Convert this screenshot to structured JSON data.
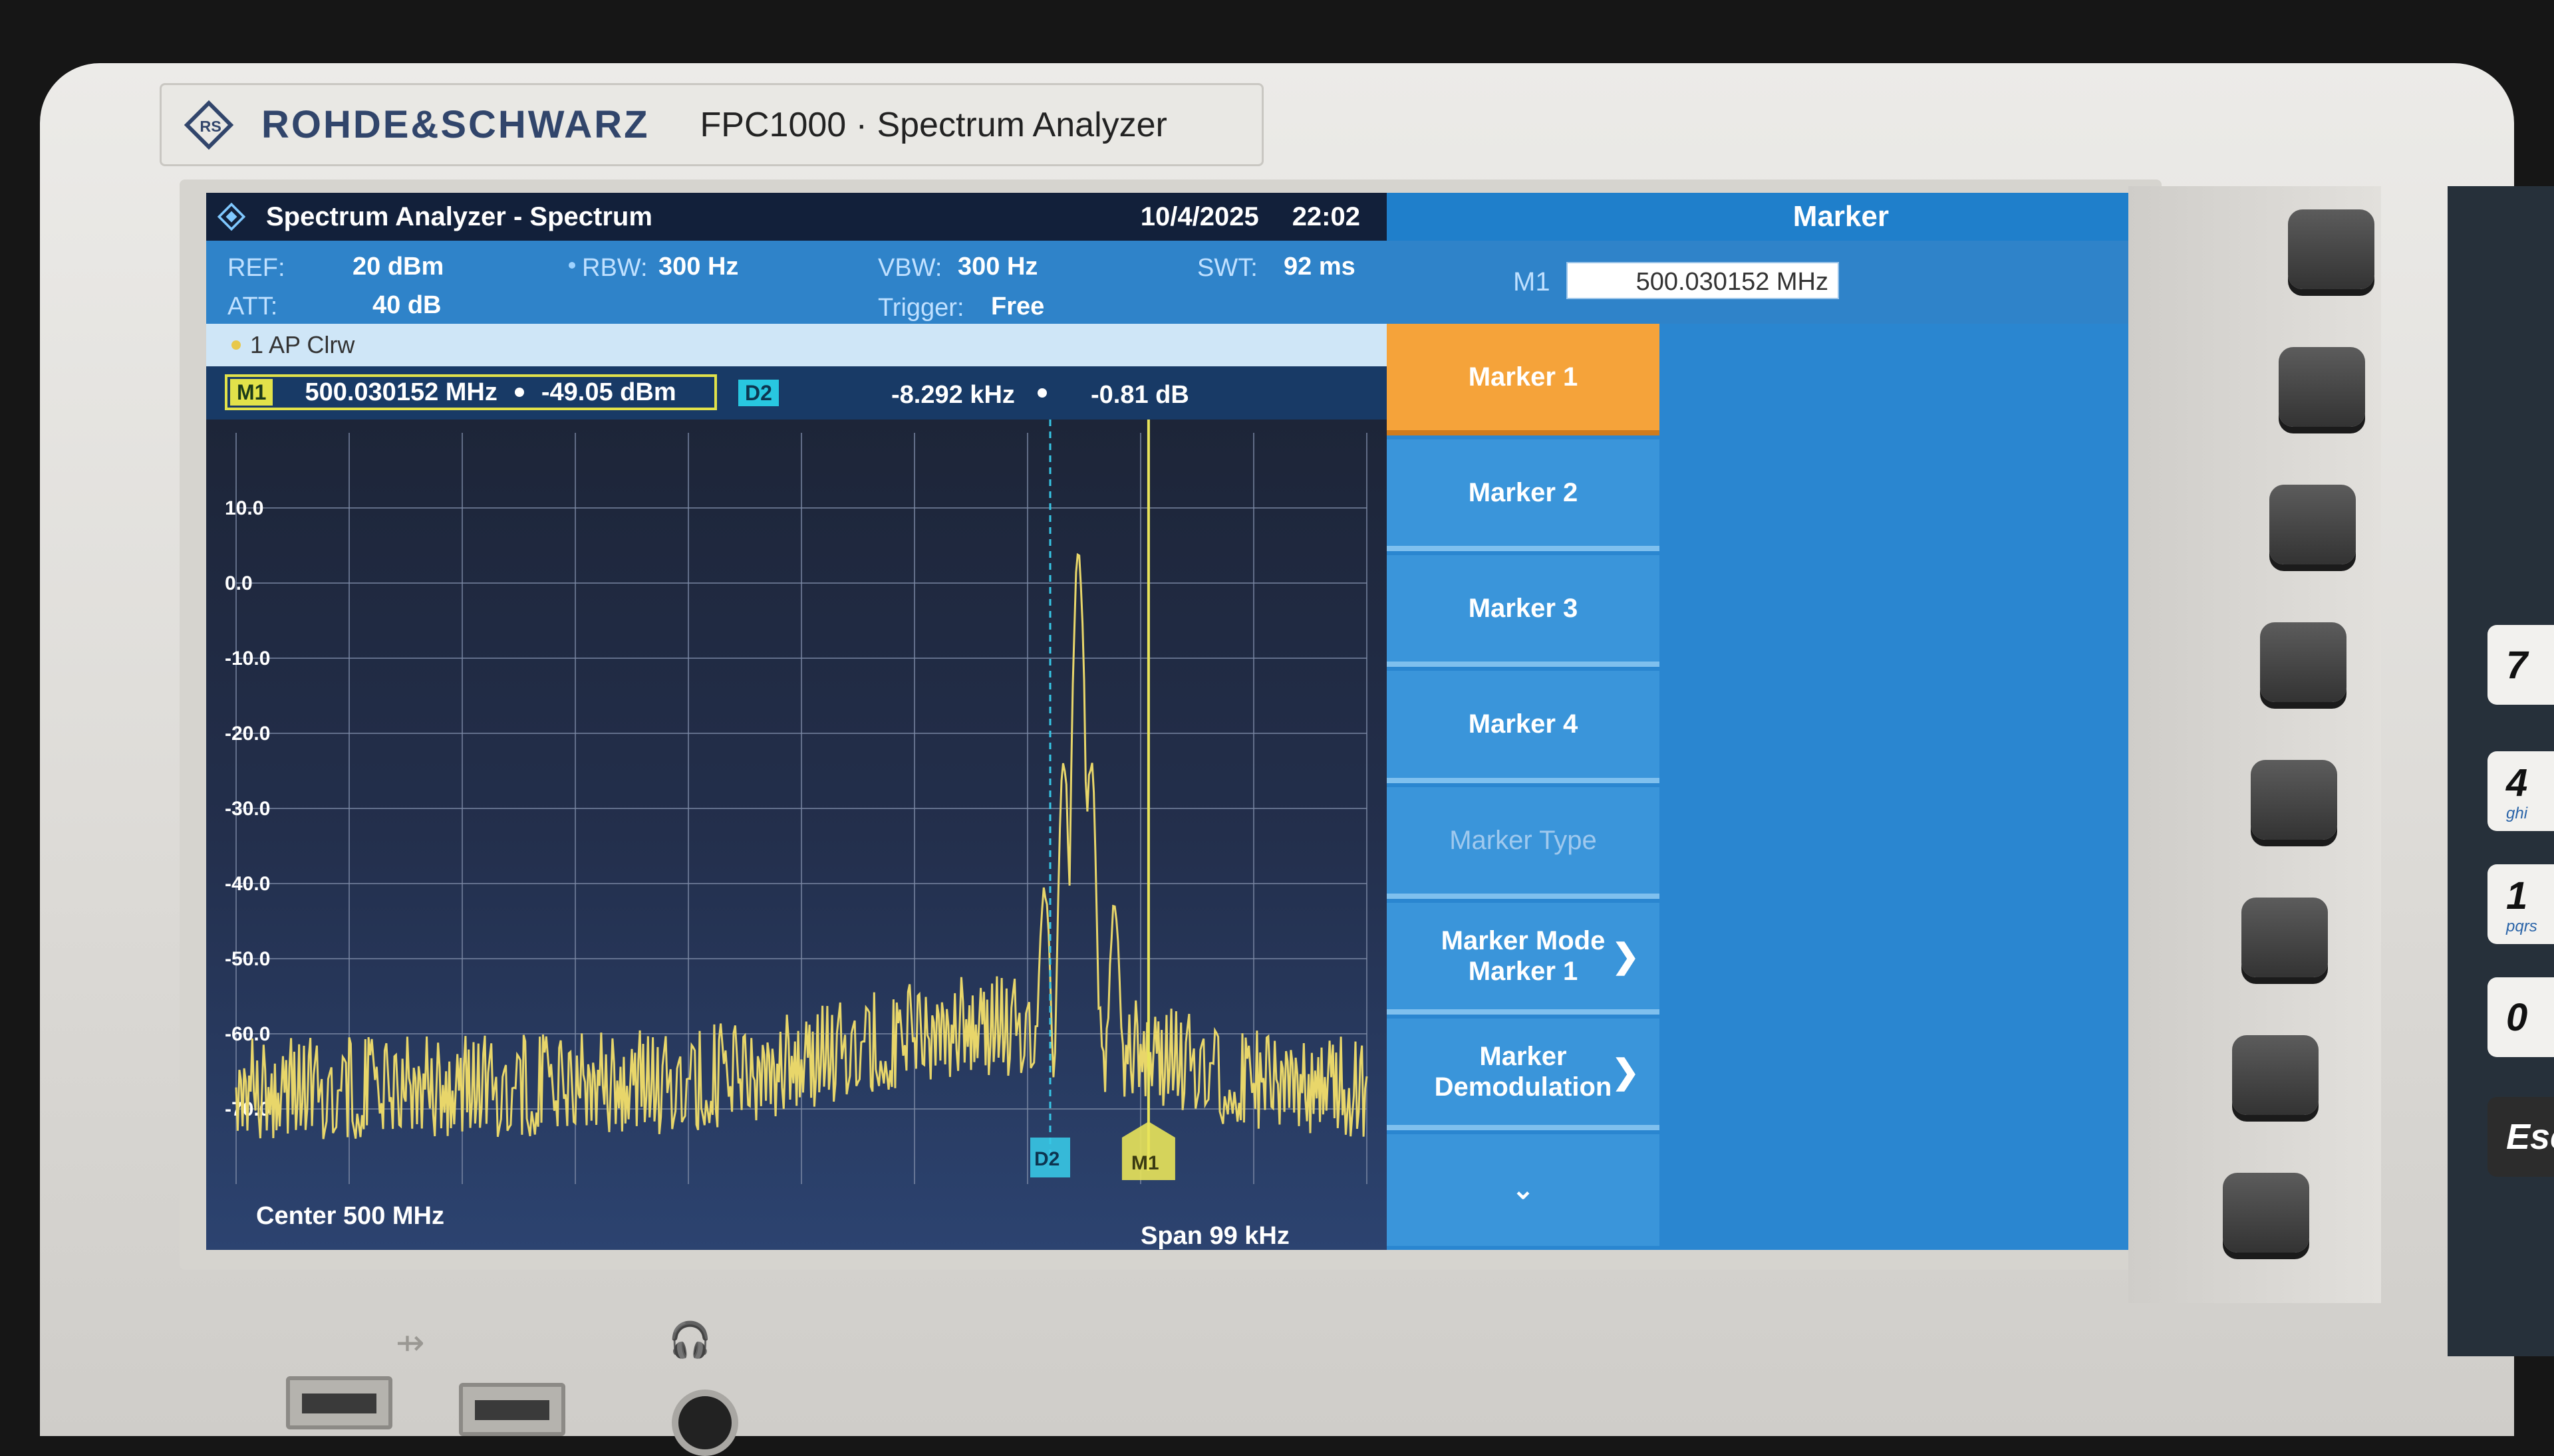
{
  "device": {
    "brand": "ROHDE&SCHWARZ",
    "model": "FPC1000 · Spectrum Analyzer"
  },
  "titlebar": {
    "app_title": "Spectrum Analyzer - Spectrum",
    "date": "10/4/2025",
    "time": "22:02"
  },
  "panel": {
    "title": "Marker"
  },
  "settings": {
    "ref_label": "REF:",
    "ref_value": "20 dBm",
    "att_label": "ATT:",
    "att_value": "40 dB",
    "rbw_label": "RBW:",
    "rbw_value": "300 Hz",
    "vbw_label": "VBW:",
    "vbw_value": "300 Hz",
    "trigger_label": "Trigger:",
    "trigger_value": "Free",
    "swt_label": "SWT:",
    "swt_value": "92 ms"
  },
  "marker_editor": {
    "label": "M1",
    "value": "500.030152 MHz"
  },
  "trace_info": "1 AP Clrw",
  "marker_readout": {
    "m1_tag": "M1",
    "m1_freq": "500.030152 MHz",
    "m1_level": "-49.05 dBm",
    "d2_tag": "D2",
    "d2_freq": "-8.292 kHz",
    "d2_level": "-0.81 dB"
  },
  "plot": {
    "center_label": "Center 500 MHz",
    "span_label": "Span 99 kHz",
    "marker_m1_label": "M1",
    "marker_d2_label": "D2",
    "m1_x_fraction": 0.807,
    "d2_x_fraction": 0.72,
    "colors": {
      "trace": "#e8d66a",
      "m1": "#e8e35a",
      "d2": "#37c6e4",
      "grid": "#7f8ca8"
    }
  },
  "chart_data": {
    "type": "line",
    "yticks": [
      "10.0",
      "0.0",
      "-10.0",
      "-20.0",
      "-30.0",
      "-40.0",
      "-50.0",
      "-60.0",
      "-70.0"
    ],
    "y_values": [
      10,
      0,
      -10,
      -20,
      -30,
      -40,
      -50,
      -60,
      -70
    ],
    "ylim": [
      -80,
      20
    ],
    "x_divisions": 10,
    "grid": true,
    "trace_name": "1 AP Clrw",
    "noise_floor_dbm": -61,
    "peaks": [
      {
        "x_fraction": 0.745,
        "dbm": 4
      },
      {
        "x_fraction": 0.732,
        "dbm": -24
      },
      {
        "x_fraction": 0.756,
        "dbm": -24
      },
      {
        "x_fraction": 0.715,
        "dbm": -41
      },
      {
        "x_fraction": 0.777,
        "dbm": -43
      }
    ]
  },
  "softkeys": [
    {
      "label": "Marker 1",
      "state": "active"
    },
    {
      "label": "Marker 2",
      "state": "normal"
    },
    {
      "label": "Marker 3",
      "state": "normal"
    },
    {
      "label": "Marker 4",
      "state": "normal"
    },
    {
      "label": "Marker Type",
      "state": "disabled"
    },
    {
      "label": "Marker Mode\nMarker 1",
      "state": "normal",
      "chevron": "❯"
    },
    {
      "label": "Marker\nDemodulation",
      "state": "normal",
      "chevron": "❯"
    },
    {
      "label": "⌄",
      "state": "more"
    }
  ],
  "keypad": [
    {
      "main": "7",
      "sub": ""
    },
    {
      "main": "4",
      "sub": "ghi"
    },
    {
      "main": "1",
      "sub": "pqrs"
    },
    {
      "main": "0",
      "sub": ""
    },
    {
      "main": "Esc",
      "sub": ""
    }
  ]
}
